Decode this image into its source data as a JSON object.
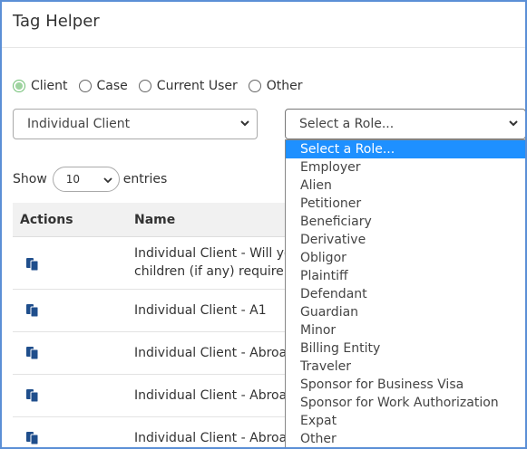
{
  "header": {
    "title": "Tag Helper"
  },
  "tag_type": {
    "options": [
      {
        "label": "Client",
        "checked": true
      },
      {
        "label": "Case",
        "checked": false
      },
      {
        "label": "Current User",
        "checked": false
      },
      {
        "label": "Other",
        "checked": false
      }
    ]
  },
  "client_select": {
    "value": "Individual Client"
  },
  "role_select": {
    "value": "Select a Role...",
    "options": [
      "Select a Role...",
      "Employer",
      "Alien",
      "Petitioner",
      "Beneficiary",
      "Derivative",
      "Obligor",
      "Plaintiff",
      "Defendant",
      "Guardian",
      "Minor",
      "Billing Entity",
      "Traveler",
      "Sponsor for Business Visa",
      "Sponsor for Work Authorization",
      "Expat",
      "Other"
    ],
    "highlight_color": "#1e90ff"
  },
  "entries": {
    "show_label": "Show",
    "value": "10",
    "suffix_label": "entries"
  },
  "table": {
    "columns": [
      "Actions",
      "Name"
    ],
    "rows": [
      {
        "name": "Individual Client - Will you",
        "name2": "children (if any) require vi",
        "action_icon": "copy-icon"
      },
      {
        "name": "Individual Client - A1",
        "action_icon": "copy-icon"
      },
      {
        "name": "Individual Client - Abroad",
        "action_icon": "copy-icon"
      },
      {
        "name": "Individual Client - Abroad",
        "action_icon": "copy-icon"
      },
      {
        "name": "Individual Client - Abroad",
        "action_icon": "copy-icon"
      }
    ]
  },
  "colors": {
    "frame_border": "#5b8fd6",
    "radio_checked": "#6fbf73",
    "icon": "#1f4e8c"
  }
}
